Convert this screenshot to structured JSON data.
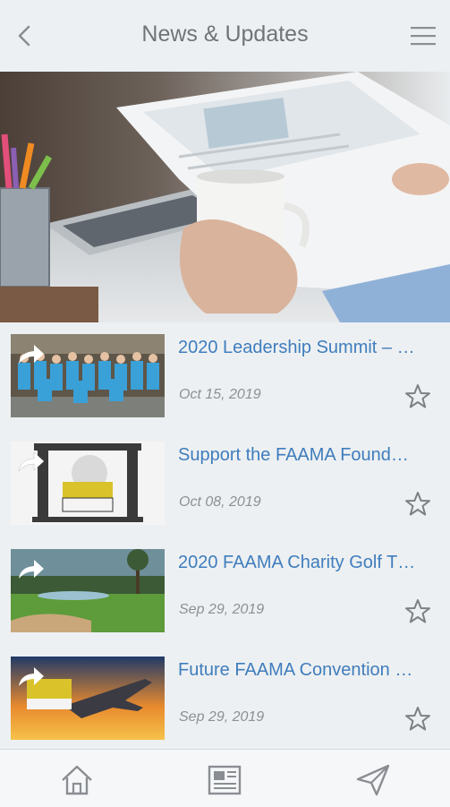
{
  "header": {
    "title": "News & Updates",
    "back_icon": "chevron-left-icon",
    "menu_icon": "hamburger-icon"
  },
  "hero": {
    "image": "desk-newspaper-coffee-photo"
  },
  "articles": [
    {
      "title": "2020 Leadership Summit – …",
      "date": "Oct 15, 2019",
      "thumb": "group-photo"
    },
    {
      "title": "Support the FAAMA Found…",
      "date": "Oct 08, 2019",
      "thumb": "faama-logo"
    },
    {
      "title": "2020 FAAMA Charity Golf T…",
      "date": "Sep 29, 2019",
      "thumb": "golf-course"
    },
    {
      "title": "Future FAAMA Convention …",
      "date": "Sep 29, 2019",
      "thumb": "airplane-sunset"
    }
  ],
  "tabbar": {
    "items": [
      "home-icon",
      "newspaper-icon",
      "send-icon"
    ]
  },
  "colors": {
    "accent": "#3f7dbd",
    "background": "#edf0f2",
    "muted": "#8c9095"
  }
}
